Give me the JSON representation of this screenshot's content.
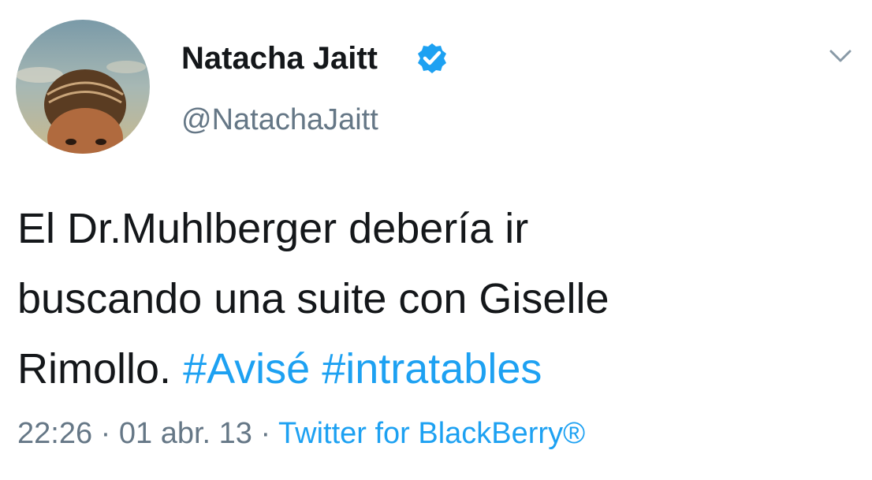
{
  "author": {
    "display_name": "Natacha Jaitt",
    "handle": "@NatachaJaitt",
    "verified_icon": "verified-badge-icon",
    "menu_icon": "chevron-down-icon"
  },
  "tweet": {
    "line1": "El Dr.Muhlberger debería ir",
    "line2": "buscando una suite con Giselle",
    "line3_text": "Rimollo.",
    "hashtags": [
      "#Avisé",
      "#intratables"
    ]
  },
  "meta": {
    "time": "22:26",
    "separator": "·",
    "date": "01 abr. 13",
    "source": "Twitter for BlackBerry®"
  },
  "colors": {
    "link": "#1da1f2",
    "secondary": "#657786",
    "text": "#14171a"
  }
}
